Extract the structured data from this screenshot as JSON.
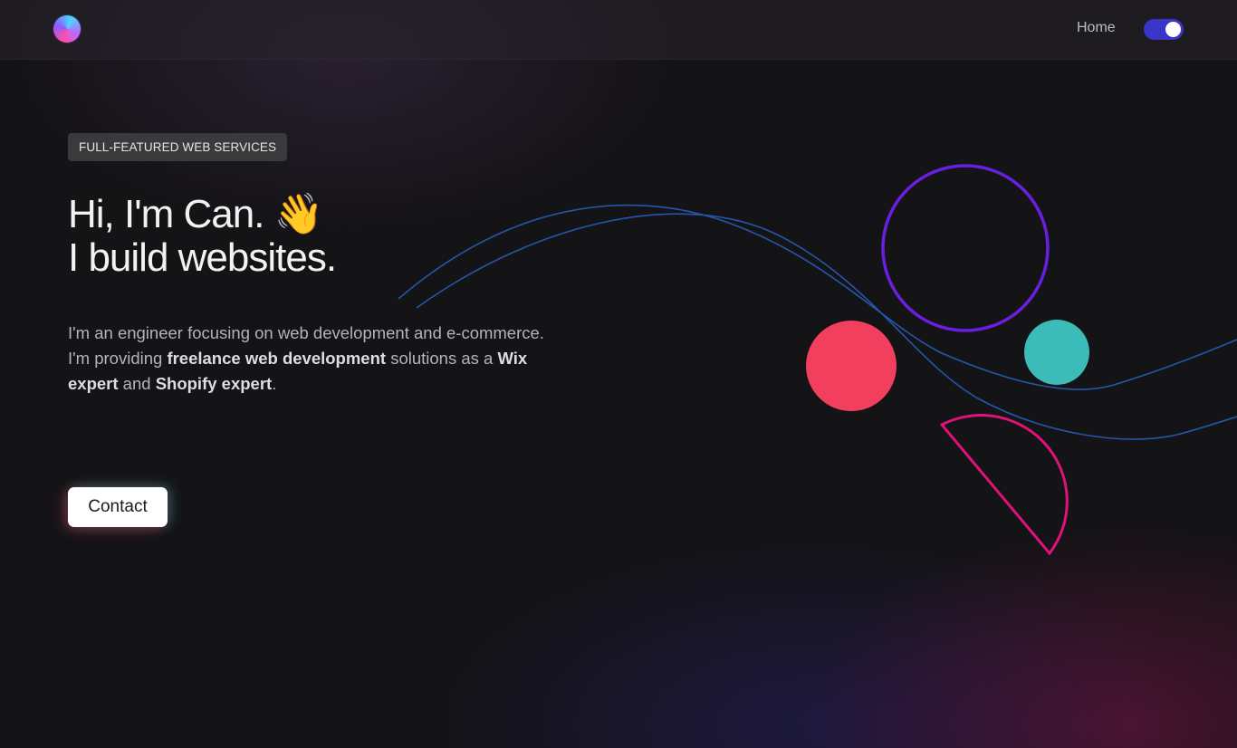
{
  "nav": {
    "home_label": "Home"
  },
  "hero": {
    "badge": "FULL-FEATURED WEB SERVICES",
    "headline_line1": "Hi, I'm Can. 👋",
    "headline_line2": "I build websites.",
    "intro": {
      "p1": "I'm an engineer focusing on web development and e-commerce.",
      "p2_pre": "I'm providing ",
      "p2_bold1": "freelance web development",
      "p2_mid": " solutions as a ",
      "p2_bold2": "Wix expert",
      "p2_and": " and ",
      "p2_bold3": "Shopify expert",
      "p2_end": "."
    },
    "contact_label": "Contact"
  },
  "colors": {
    "background": "#141316",
    "toggle": "#3a34c9",
    "ring": "#6a1fe0",
    "red_circle": "#f23f5e",
    "teal_circle": "#3bbcb8",
    "semicircle": "#e0127a",
    "waves": "#2a62c4"
  },
  "icons": {
    "logo": "gradient-orb-logo",
    "wave": "waving-hand-emoji"
  }
}
